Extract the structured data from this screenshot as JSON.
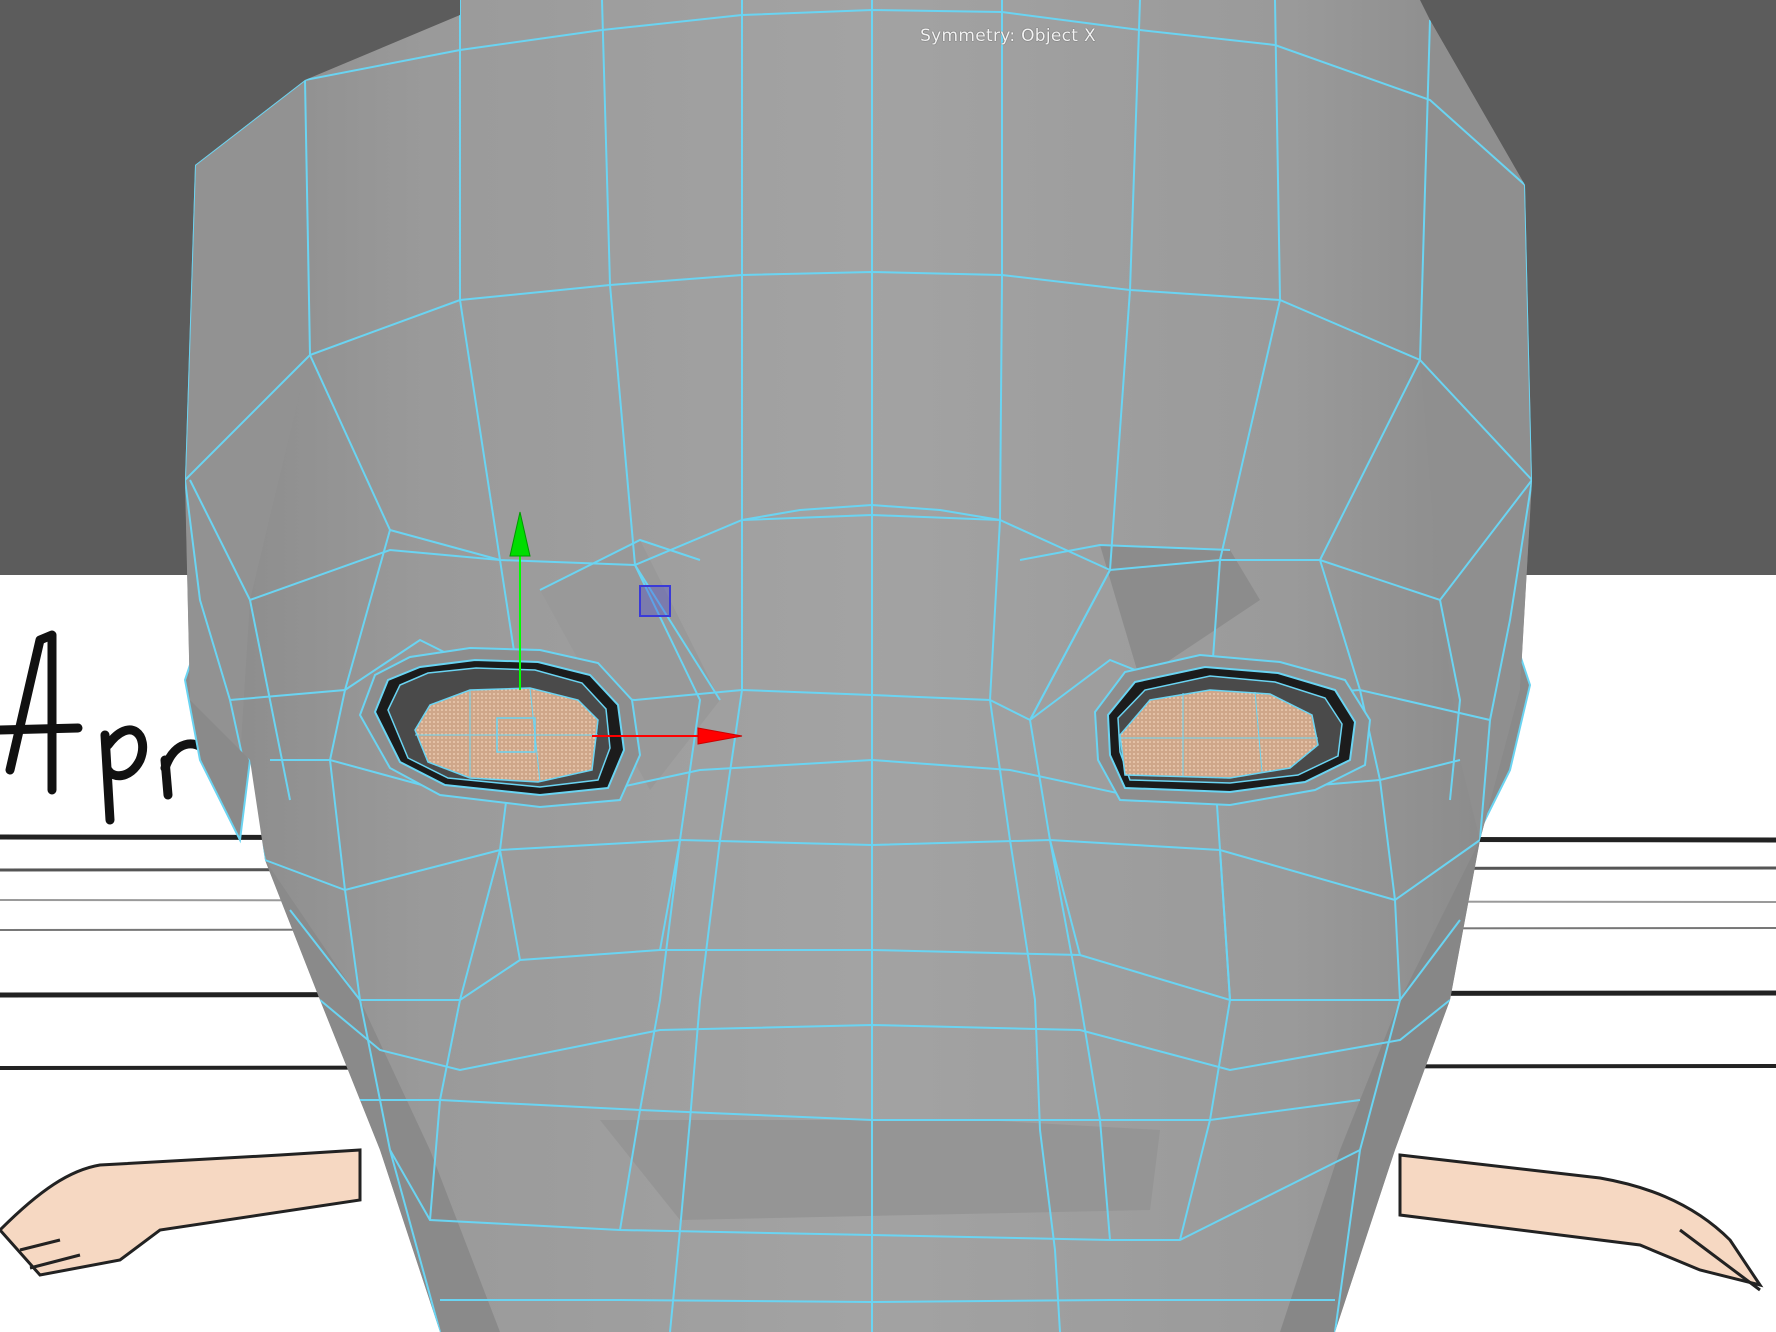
{
  "viewport": {
    "hud": {
      "symmetry_label": "Symmetry: Object X"
    },
    "reference_image": {
      "handwritten_text": "Apr"
    },
    "manipulator": {
      "type": "move",
      "axes": [
        "x",
        "y",
        "z"
      ]
    },
    "colors": {
      "background": "#5c5c5c",
      "mesh_fill": "#9d9d9d",
      "wireframe": "#6ad4f2",
      "x_axis": "#ff0000",
      "y_axis": "#00ff00",
      "z_axis": "#3a3ad8",
      "eye_fill": "#d9b496",
      "skin": "#f6d8c2",
      "reference_paper": "#ffffff"
    }
  }
}
